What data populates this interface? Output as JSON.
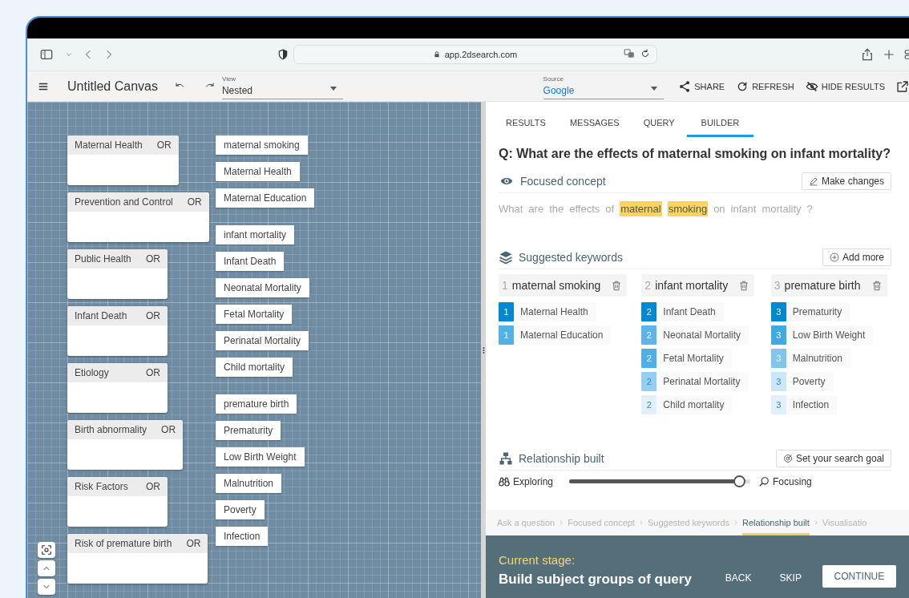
{
  "browser": {
    "url": "app.2dsearch.com"
  },
  "toolbar": {
    "title": "Untitled Canvas",
    "view": {
      "label": "View",
      "value": "Nested"
    },
    "source": {
      "label": "Source",
      "value": "Google"
    },
    "actions": [
      {
        "kind": "share",
        "label": "SHARE"
      },
      {
        "kind": "refresh",
        "label": "REFRESH"
      },
      {
        "kind": "hide",
        "label": "HIDE RESULTS"
      }
    ]
  },
  "canvas": {
    "groups": [
      {
        "name": "Maternal Health",
        "operator": "OR"
      },
      {
        "name": "Prevention and Control",
        "operator": "OR"
      },
      {
        "name": "Public Health",
        "operator": "OR"
      },
      {
        "name": "Infant Death",
        "operator": "OR"
      },
      {
        "name": "Etiology",
        "operator": "OR"
      },
      {
        "name": "Birth abnormality",
        "operator": "OR"
      },
      {
        "name": "Risk Factors",
        "operator": "OR"
      },
      {
        "name": "Risk of premature birth",
        "operator": "OR"
      }
    ],
    "term_groups": [
      {
        "terms": [
          "maternal smoking",
          "Maternal Health",
          "Maternal Education"
        ]
      },
      {
        "terms": [
          "infant mortality",
          "Infant Death",
          "Neonatal Mortality",
          "Fetal Mortality",
          "Perinatal Mortality",
          "Child mortality"
        ]
      },
      {
        "terms": [
          "premature birth",
          "Prematurity",
          "Low Birth Weight",
          "Malnutrition",
          "Poverty",
          "Infection"
        ]
      }
    ]
  },
  "panel": {
    "tabs": [
      {
        "label": "RESULTS",
        "selected": false
      },
      {
        "label": "MESSAGES",
        "selected": false
      },
      {
        "label": "QUERY",
        "selected": false
      },
      {
        "label": "BUILDER",
        "selected": true
      }
    ],
    "question": "Q: What are the effects of maternal smoking on infant mortality?",
    "focused": {
      "title": "Focused concept",
      "action": "Make changes",
      "words": [
        {
          "text": "What",
          "highlight": false
        },
        {
          "text": "are",
          "highlight": false
        },
        {
          "text": "the",
          "highlight": false
        },
        {
          "text": "effects",
          "highlight": false
        },
        {
          "text": "of",
          "highlight": false
        },
        {
          "text": "maternal",
          "highlight": true
        },
        {
          "text": "smoking",
          "highlight": true
        },
        {
          "text": "on",
          "highlight": false
        },
        {
          "text": "infant",
          "highlight": false
        },
        {
          "text": "mortality",
          "highlight": false
        },
        {
          "text": "?",
          "highlight": false
        }
      ]
    },
    "keywords": {
      "title": "Suggested keywords",
      "action": "Add more",
      "columns": [
        {
          "number": "1",
          "name": "maternal smoking",
          "items": [
            {
              "label": "Maternal Health",
              "badge": "1",
              "color": "#0288d1"
            },
            {
              "label": "Maternal Education",
              "badge": "1",
              "color": "#4fb3e8"
            }
          ]
        },
        {
          "number": "2",
          "name": "infant mortality",
          "items": [
            {
              "label": "Infant Death",
              "badge": "2",
              "color": "#0288d1"
            },
            {
              "label": "Neonatal Mortality",
              "badge": "2",
              "color": "#5ab6e9"
            },
            {
              "label": "Fetal Mortality",
              "badge": "2",
              "color": "#4fb0e6"
            },
            {
              "label": "Perinatal Mortality",
              "badge": "2",
              "color": "#93cff1"
            },
            {
              "label": "Child mortality",
              "badge": "2",
              "color": "#e1f1fb"
            }
          ]
        },
        {
          "number": "3",
          "name": "premature birth",
          "items": [
            {
              "label": "Prematurity",
              "badge": "3",
              "color": "#0288d1"
            },
            {
              "label": "Low Birth Weight",
              "badge": "3",
              "color": "#3fa9e2"
            },
            {
              "label": "Malnutrition",
              "badge": "3",
              "color": "#7fc5ec"
            },
            {
              "label": "Poverty",
              "badge": "3",
              "color": "#cbe7f7"
            },
            {
              "label": "Infection",
              "badge": "3",
              "color": "#e1f1fb"
            }
          ]
        }
      ]
    },
    "relationship": {
      "title": "Relationship built",
      "action": "Set your search goal",
      "left": "Exploring",
      "right": "Focusing",
      "level": 0.97
    },
    "breadcrumbs": [
      {
        "label": "Ask a question",
        "selected": false
      },
      {
        "label": "Focused concept",
        "selected": false
      },
      {
        "label": "Suggested keywords",
        "selected": false
      },
      {
        "label": "Relationship built",
        "selected": true
      },
      {
        "label": "Visualisatio",
        "selected": false
      }
    ],
    "stage": {
      "label": "Current stage:",
      "title": "Build subject groups of query",
      "buttons": [
        {
          "kind": "text",
          "label": "BACK"
        },
        {
          "kind": "text",
          "label": "SKIP"
        },
        {
          "kind": "primary",
          "label": "CONTINUE"
        }
      ]
    }
  }
}
